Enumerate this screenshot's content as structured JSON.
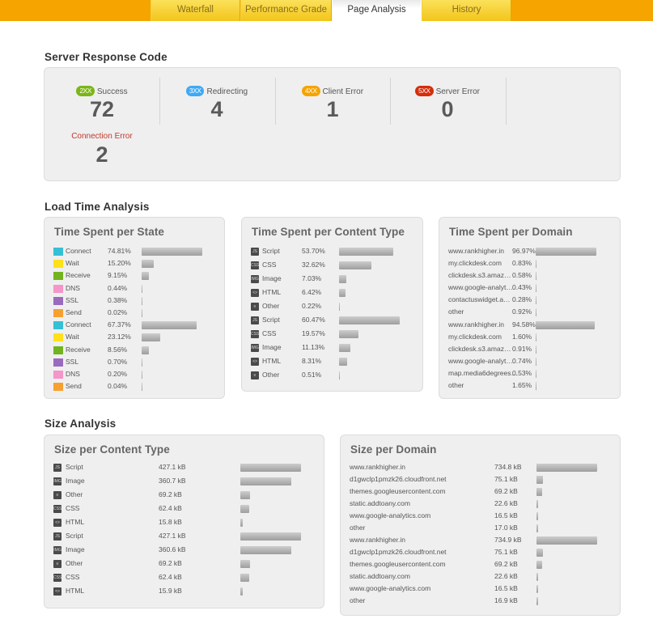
{
  "tabs": [
    {
      "label": "Waterfall",
      "active": false
    },
    {
      "label": "Performance Grade",
      "active": false
    },
    {
      "label": "Page Analysis",
      "active": true
    },
    {
      "label": "History",
      "active": false
    }
  ],
  "server_response": {
    "title": "Server Response Code",
    "codes": [
      {
        "badge": "2XX",
        "label": "Success",
        "value": "72",
        "color": "#7cb518"
      },
      {
        "badge": "3XX",
        "label": "Redirecting",
        "value": "4",
        "color": "#3fa9f5"
      },
      {
        "badge": "4XX",
        "label": "Client Error",
        "value": "1",
        "color": "#f5a400"
      },
      {
        "badge": "5XX",
        "label": "Server Error",
        "value": "0",
        "color": "#d62d0a"
      }
    ],
    "connection_error": {
      "label": "Connection Error",
      "value": "2"
    }
  },
  "load_time": {
    "title": "Load Time Analysis",
    "per_state": {
      "title": "Time Spent per State",
      "rows": [
        {
          "label": "Connect",
          "value": "74.81%",
          "pct": 74.81,
          "color": "#35c0d5"
        },
        {
          "label": "Wait",
          "value": "15.20%",
          "pct": 15.2,
          "color": "#ffe01a"
        },
        {
          "label": "Receive",
          "value": "9.15%",
          "pct": 9.15,
          "color": "#72b31f"
        },
        {
          "label": "DNS",
          "value": "0.44%",
          "pct": 0.44,
          "color": "#f595c8"
        },
        {
          "label": "SSL",
          "value": "0.38%",
          "pct": 0.38,
          "color": "#9a6abf"
        },
        {
          "label": "Send",
          "value": "0.02%",
          "pct": 0.02,
          "color": "#f7a030"
        },
        {
          "label": "Connect",
          "value": "67.37%",
          "pct": 67.37,
          "color": "#35c0d5"
        },
        {
          "label": "Wait",
          "value": "23.12%",
          "pct": 23.12,
          "color": "#ffe01a"
        },
        {
          "label": "Receive",
          "value": "8.56%",
          "pct": 8.56,
          "color": "#72b31f"
        },
        {
          "label": "SSL",
          "value": "0.70%",
          "pct": 0.7,
          "color": "#9a6abf"
        },
        {
          "label": "DNS",
          "value": "0.20%",
          "pct": 0.2,
          "color": "#f595c8"
        },
        {
          "label": "Send",
          "value": "0.04%",
          "pct": 0.04,
          "color": "#f7a030"
        }
      ]
    },
    "per_content_type": {
      "title": "Time Spent per Content Type",
      "rows": [
        {
          "label": "Script",
          "icon": "JS",
          "value": "53.70%",
          "pct": 53.7
        },
        {
          "label": "CSS",
          "icon": "CSS",
          "value": "32.62%",
          "pct": 32.62
        },
        {
          "label": "Image",
          "icon": "IMG",
          "value": "7.03%",
          "pct": 7.03
        },
        {
          "label": "HTML",
          "icon": "<>",
          "value": "6.42%",
          "pct": 6.42
        },
        {
          "label": "Other",
          "icon": "≡",
          "value": "0.22%",
          "pct": 0.22
        },
        {
          "label": "Script",
          "icon": "JS",
          "value": "60.47%",
          "pct": 60.47
        },
        {
          "label": "CSS",
          "icon": "CSS",
          "value": "19.57%",
          "pct": 19.57
        },
        {
          "label": "Image",
          "icon": "IMG",
          "value": "11.13%",
          "pct": 11.13
        },
        {
          "label": "HTML",
          "icon": "<>",
          "value": "8.31%",
          "pct": 8.31
        },
        {
          "label": "Other",
          "icon": "≡",
          "value": "0.51%",
          "pct": 0.51
        }
      ]
    },
    "per_domain": {
      "title": "Time Spent per Domain",
      "rows": [
        {
          "label": "www.rankhigher.in",
          "value": "96.97%",
          "pct": 96.97
        },
        {
          "label": "my.clickdesk.com",
          "value": "0.83%",
          "pct": 0.83
        },
        {
          "label": "clickdesk.s3.amaz…",
          "value": "0.58%",
          "pct": 0.58
        },
        {
          "label": "www.google-analyt…",
          "value": "0.43%",
          "pct": 0.43
        },
        {
          "label": "contactuswidget.a…",
          "value": "0.28%",
          "pct": 0.28
        },
        {
          "label": "other",
          "value": "0.92%",
          "pct": 0.92
        },
        {
          "label": "www.rankhigher.in",
          "value": "94.58%",
          "pct": 94.58
        },
        {
          "label": "my.clickdesk.com",
          "value": "1.60%",
          "pct": 1.6
        },
        {
          "label": "clickdesk.s3.amaz…",
          "value": "0.91%",
          "pct": 0.91
        },
        {
          "label": "www.google-analyt…",
          "value": "0.74%",
          "pct": 0.74
        },
        {
          "label": "map.media6degrees…",
          "value": "0.53%",
          "pct": 0.53
        },
        {
          "label": "other",
          "value": "1.65%",
          "pct": 1.65
        }
      ]
    }
  },
  "size": {
    "title": "Size Analysis",
    "per_content_type": {
      "title": "Size per Content Type",
      "rows": [
        {
          "label": "Script",
          "icon": "JS",
          "value": "427.1 kB",
          "kb": 427.1
        },
        {
          "label": "Image",
          "icon": "IMG",
          "value": "360.7 kB",
          "kb": 360.7
        },
        {
          "label": "Other",
          "icon": "≡",
          "value": "69.2 kB",
          "kb": 69.2
        },
        {
          "label": "CSS",
          "icon": "CSS",
          "value": "62.4 kB",
          "kb": 62.4
        },
        {
          "label": "HTML",
          "icon": "<>",
          "value": "15.8 kB",
          "kb": 15.8
        },
        {
          "label": "Script",
          "icon": "JS",
          "value": "427.1 kB",
          "kb": 427.1
        },
        {
          "label": "Image",
          "icon": "IMG",
          "value": "360.6 kB",
          "kb": 360.6
        },
        {
          "label": "Other",
          "icon": "≡",
          "value": "69.2 kB",
          "kb": 69.2
        },
        {
          "label": "CSS",
          "icon": "CSS",
          "value": "62.4 kB",
          "kb": 62.4
        },
        {
          "label": "HTML",
          "icon": "<>",
          "value": "15.9 kB",
          "kb": 15.9
        }
      ]
    },
    "per_domain": {
      "title": "Size per Domain",
      "rows": [
        {
          "label": "www.rankhigher.in",
          "value": "734.8 kB",
          "kb": 734.8
        },
        {
          "label": "d1gwclp1pmzk26.cloudfront.net",
          "value": "75.1 kB",
          "kb": 75.1
        },
        {
          "label": "themes.googleusercontent.com",
          "value": "69.2 kB",
          "kb": 69.2
        },
        {
          "label": "static.addtoany.com",
          "value": "22.6 kB",
          "kb": 22.6
        },
        {
          "label": "www.google-analytics.com",
          "value": "16.5 kB",
          "kb": 16.5
        },
        {
          "label": "other",
          "value": "17.0 kB",
          "kb": 17.0
        },
        {
          "label": "www.rankhigher.in",
          "value": "734.9 kB",
          "kb": 734.9
        },
        {
          "label": "d1gwclp1pmzk26.cloudfront.net",
          "value": "75.1 kB",
          "kb": 75.1
        },
        {
          "label": "themes.googleusercontent.com",
          "value": "69.2 kB",
          "kb": 69.2
        },
        {
          "label": "static.addtoany.com",
          "value": "22.6 kB",
          "kb": 22.6
        },
        {
          "label": "www.google-analytics.com",
          "value": "16.5 kB",
          "kb": 16.5
        },
        {
          "label": "other",
          "value": "16.9 kB",
          "kb": 16.9
        }
      ]
    }
  }
}
